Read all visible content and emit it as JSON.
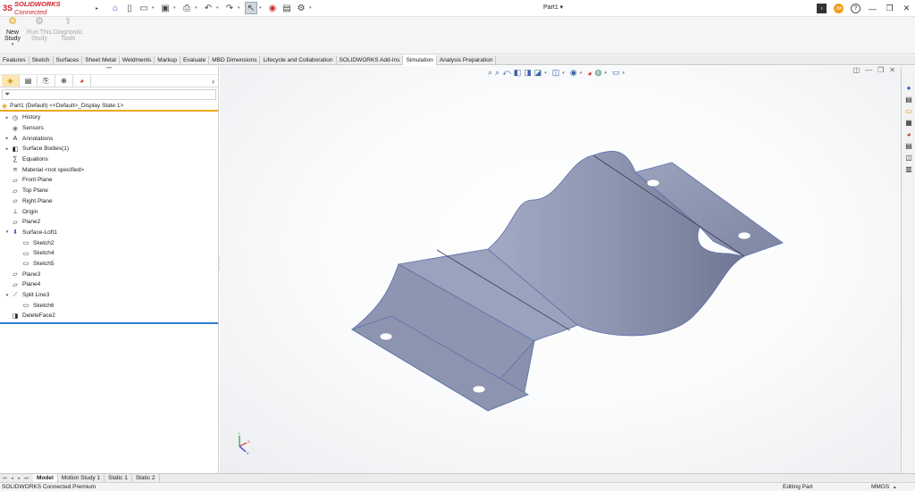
{
  "app": {
    "brand_mark": "3S",
    "brand_name": "SOLIDWORKS",
    "brand_suffix": "Connected",
    "document_title": "Part1 ▾",
    "user_initials": "JM"
  },
  "quick_access": [
    {
      "icon": "home-icon",
      "glyph": "⌂"
    },
    {
      "icon": "new-document-icon",
      "glyph": "▯"
    },
    {
      "icon": "open-folder-icon",
      "glyph": "▭"
    },
    {
      "icon": "save-icon",
      "glyph": "▣"
    },
    {
      "icon": "print-icon",
      "glyph": "⎙"
    },
    {
      "icon": "undo-icon",
      "glyph": "↶"
    },
    {
      "icon": "redo-icon",
      "glyph": "↷"
    },
    {
      "icon": "select-arrow-icon",
      "glyph": "↖"
    },
    {
      "icon": "traffic-light-icon",
      "glyph": "◉"
    },
    {
      "icon": "file-properties-icon",
      "glyph": "▤"
    },
    {
      "icon": "options-gear-icon",
      "glyph": "⚙"
    }
  ],
  "command_manager": {
    "new_study": {
      "line1": "New",
      "line2": "Study",
      "icon": "new-study-icon"
    },
    "run_study": {
      "line1": "Run This",
      "line2": "Study",
      "icon": "run-study-icon"
    },
    "diagnostic": {
      "line1": "Diagnostic",
      "line2": "Tools",
      "icon": "diagnostic-tools-icon"
    }
  },
  "tabs": [
    "Features",
    "Sketch",
    "Surfaces",
    "Sheet Metal",
    "Weldments",
    "Markup",
    "Evaluate",
    "MBD Dimensions",
    "Lifecycle and Collaboration",
    "SOLIDWORKS Add-Ins",
    "Simulation",
    "Analysis Preparation"
  ],
  "active_tab": "Simulation",
  "feature_manager": {
    "root": "Part1 (Default) <<Default>_Display State 1>",
    "tree": [
      {
        "label": "History",
        "level": 1,
        "expander": "▸",
        "icon": "history-icon"
      },
      {
        "label": "Sensors",
        "level": 1,
        "expander": "",
        "icon": "sensors-icon"
      },
      {
        "label": "Annotations",
        "level": 1,
        "expander": "▸",
        "icon": "annotations-icon"
      },
      {
        "label": "Surface Bodies(1)",
        "level": 1,
        "expander": "▸",
        "icon": "surface-bodies-icon"
      },
      {
        "label": "Equations",
        "level": 1,
        "expander": "",
        "icon": "equations-icon"
      },
      {
        "label": "Material <not specified>",
        "level": 1,
        "expander": "",
        "icon": "material-icon"
      },
      {
        "label": "Front Plane",
        "level": 1,
        "expander": "",
        "icon": "plane-icon"
      },
      {
        "label": "Top Plane",
        "level": 1,
        "expander": "",
        "icon": "plane-icon"
      },
      {
        "label": "Right Plane",
        "level": 1,
        "expander": "",
        "icon": "plane-icon"
      },
      {
        "label": "Origin",
        "level": 1,
        "expander": "",
        "icon": "origin-icon"
      },
      {
        "label": "Plane2",
        "level": 1,
        "expander": "",
        "icon": "plane-icon"
      },
      {
        "label": "Surface-Loft1",
        "level": 1,
        "expander": "▾",
        "icon": "surface-loft-icon"
      },
      {
        "label": "Sketch2",
        "level": 2,
        "expander": "",
        "icon": "sketch-icon"
      },
      {
        "label": "Sketch4",
        "level": 2,
        "expander": "",
        "icon": "sketch-icon"
      },
      {
        "label": "Sketch5",
        "level": 2,
        "expander": "",
        "icon": "sketch-icon"
      },
      {
        "label": "Plane3",
        "level": 1,
        "expander": "",
        "icon": "plane-icon"
      },
      {
        "label": "Plane4",
        "level": 1,
        "expander": "",
        "icon": "plane-icon"
      },
      {
        "label": "Split Line3",
        "level": 1,
        "expander": "▾",
        "icon": "split-line-icon"
      },
      {
        "label": "Sketch6",
        "level": 2,
        "expander": "",
        "icon": "sketch-icon"
      },
      {
        "label": "DeleteFace2",
        "level": 1,
        "expander": "",
        "icon": "delete-face-icon"
      }
    ]
  },
  "bottom_tabs": [
    "Model",
    "Motion Study 1",
    "Static 1",
    "Static 2"
  ],
  "active_bottom_tab": "Model",
  "status": {
    "left": "SOLIDWORKS Connected Premium",
    "mode": "Editing Part",
    "units": "MMGS",
    "units_arrow": "▴"
  },
  "colors": {
    "brand": "#d1202a",
    "accent": "#f0a81c",
    "rollback": "#2f7fd1",
    "part_face": "#8a92ad"
  }
}
